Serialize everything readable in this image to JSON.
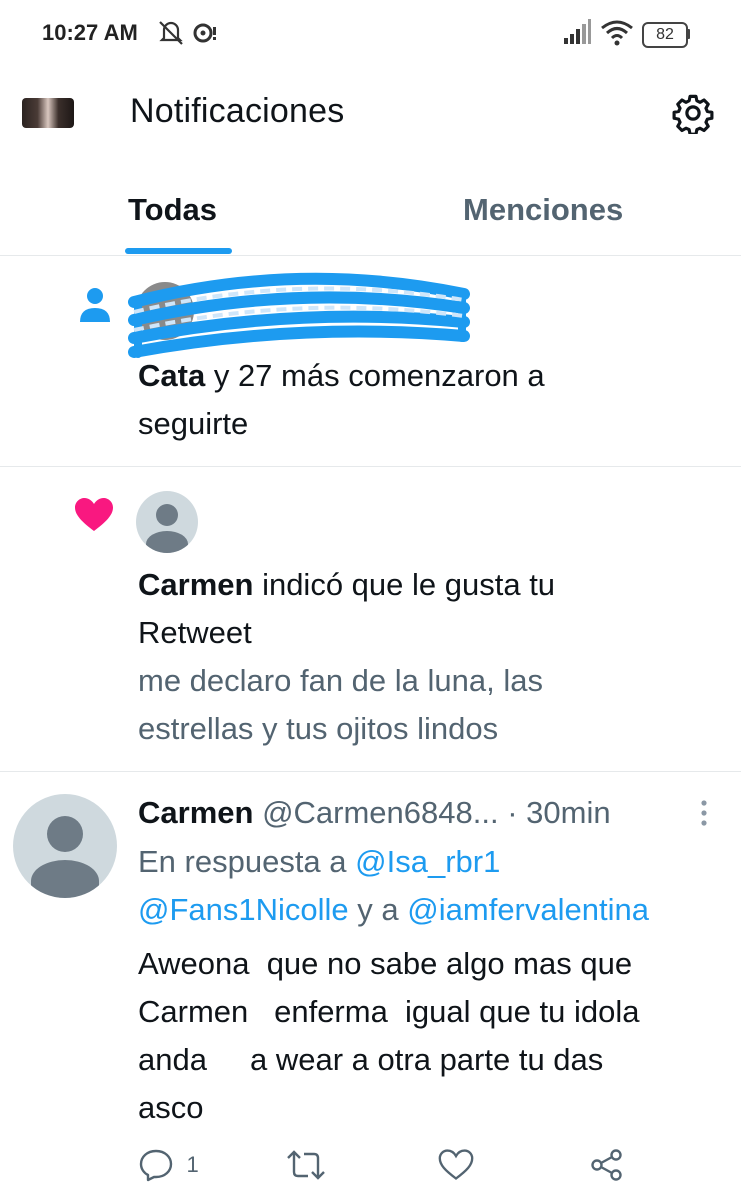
{
  "status_bar": {
    "time": "10:27 AM",
    "battery": "82"
  },
  "header": {
    "title": "Notificaciones"
  },
  "tabs": [
    {
      "label": "Todas",
      "active": true
    },
    {
      "label": "Menciones",
      "active": false
    }
  ],
  "notifications": [
    {
      "type": "follow",
      "name": "Cata",
      "text": "y 27 más comenzaron a",
      "text2": "seguirte"
    },
    {
      "type": "like",
      "name": "Carmen",
      "text": "indicó que le gusta tu",
      "text2": "Retweet",
      "quote1": "me declaro fan de la luna, las",
      "quote2": "estrellas y tus ojitos lindos"
    },
    {
      "type": "reply",
      "name": "Carmen",
      "handle": "@Carmen6848...",
      "time": "· 30min",
      "reply_prefix": "En respuesta a",
      "reply_to_1": "@Isa_rbr1",
      "reply_to_2": "@Fans1Nicolle",
      "reply_and": "y a",
      "reply_to_3": "@iamfervalentina",
      "body": [
        "Aweona  que no sabe algo mas que",
        "Carmen   enferma  igual que tu idola",
        "anda     a wear a otra parte tu das",
        "asco"
      ],
      "reply_count": "1"
    }
  ],
  "colors": {
    "accent": "#1d9bf0",
    "like": "#f91880",
    "text": "#0f1419",
    "muted": "#536471"
  }
}
